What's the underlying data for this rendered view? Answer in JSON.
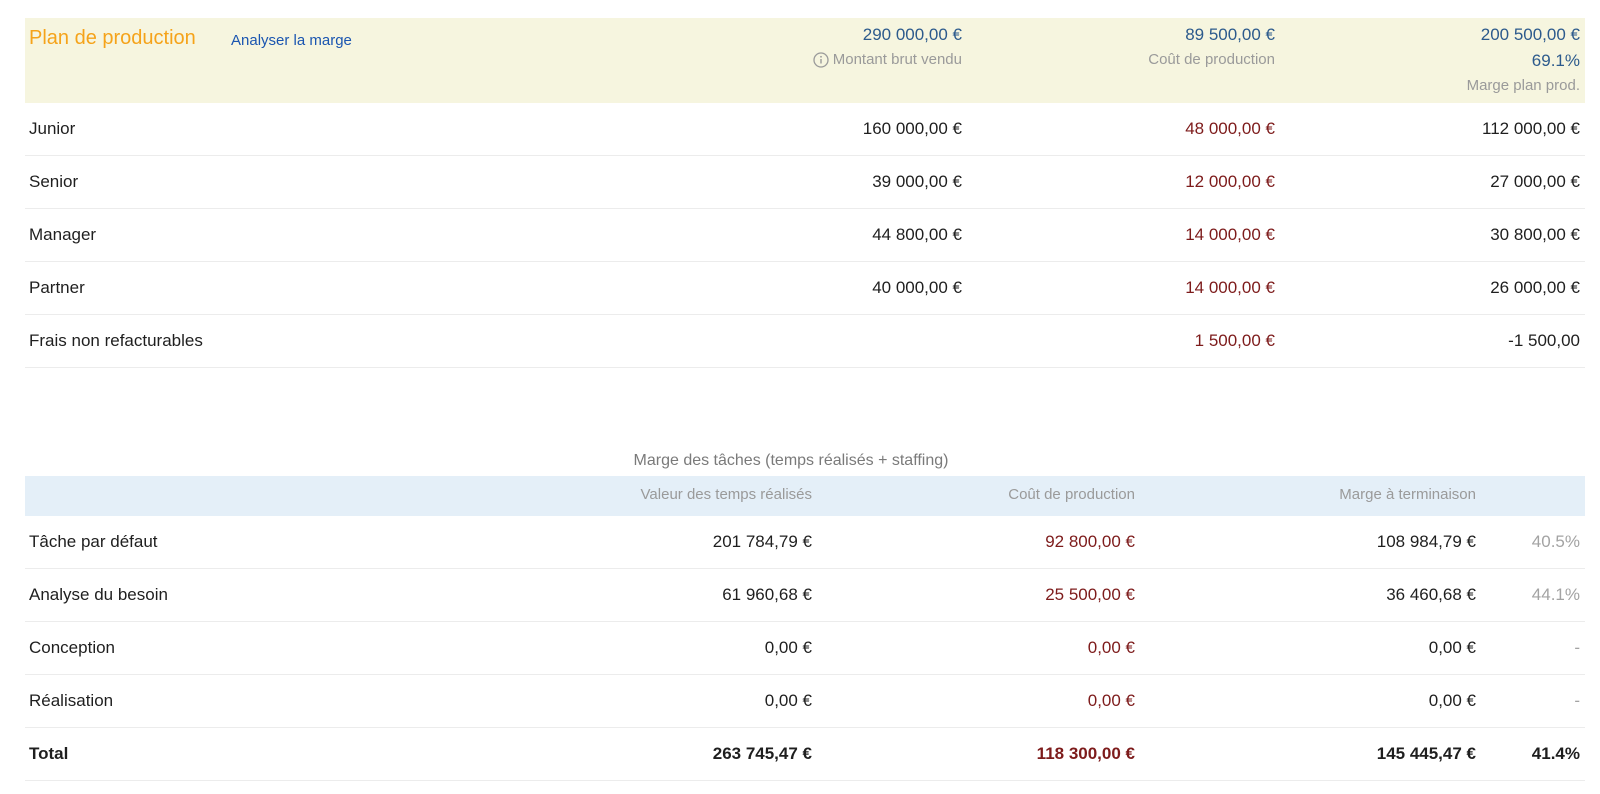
{
  "plan": {
    "title": "Plan de production",
    "link": "Analyser la marge",
    "totals": {
      "gross_amount": "290 000,00 €",
      "gross_label": "Montant brut vendu",
      "production_cost": "89 500,00 €",
      "production_cost_label": "Coût de production",
      "margin": "200 500,00 €",
      "margin_pct": "69.1%",
      "margin_label": "Marge plan prod."
    },
    "rows": [
      {
        "name": "Junior",
        "sold": "160 000,00 €",
        "cost": "48 000,00 €",
        "margin": "112 000,00 €"
      },
      {
        "name": "Senior",
        "sold": "39 000,00 €",
        "cost": "12 000,00 €",
        "margin": "27 000,00 €"
      },
      {
        "name": "Manager",
        "sold": "44 800,00 €",
        "cost": "14 000,00 €",
        "margin": "30 800,00 €"
      },
      {
        "name": "Partner",
        "sold": "40 000,00 €",
        "cost": "14 000,00 €",
        "margin": "26 000,00 €"
      },
      {
        "name": "Frais non refacturables",
        "sold": "",
        "cost": "1 500,00 €",
        "margin": "-1 500,00"
      }
    ]
  },
  "tasks": {
    "title": "Marge des tâches (temps réalisés + staffing)",
    "headers": {
      "value": "Valeur des temps réalisés",
      "cost": "Coût de production",
      "margin": "Marge à terminaison"
    },
    "rows": [
      {
        "name": "Tâche par défaut",
        "value": "201 784,79 €",
        "cost": "92 800,00 €",
        "margin": "108 984,79 €",
        "pct": "40.5%"
      },
      {
        "name": "Analyse du besoin",
        "value": "61 960,68 €",
        "cost": "25 500,00 €",
        "margin": "36 460,68 €",
        "pct": "44.1%"
      },
      {
        "name": "Conception",
        "value": "0,00 €",
        "cost": "0,00 €",
        "margin": "0,00 €",
        "pct": "-"
      },
      {
        "name": "Réalisation",
        "value": "0,00 €",
        "cost": "0,00 €",
        "margin": "0,00 €",
        "pct": "-"
      }
    ],
    "total": {
      "name": "Total",
      "value": "263 745,47 €",
      "cost": "118 300,00 €",
      "margin": "145 445,47 €",
      "pct": "41.4%"
    }
  },
  "colors": {
    "title_orange": "#f5a31a",
    "link_blue": "#1a55b0",
    "header_amount_blue": "#2c5a8c",
    "cost_red": "#7d1b1b",
    "plan_header_bg": "#f6f5df",
    "task_header_bg": "#e4eff8"
  },
  "icons": {
    "gross_label_icon": "info-icon"
  }
}
